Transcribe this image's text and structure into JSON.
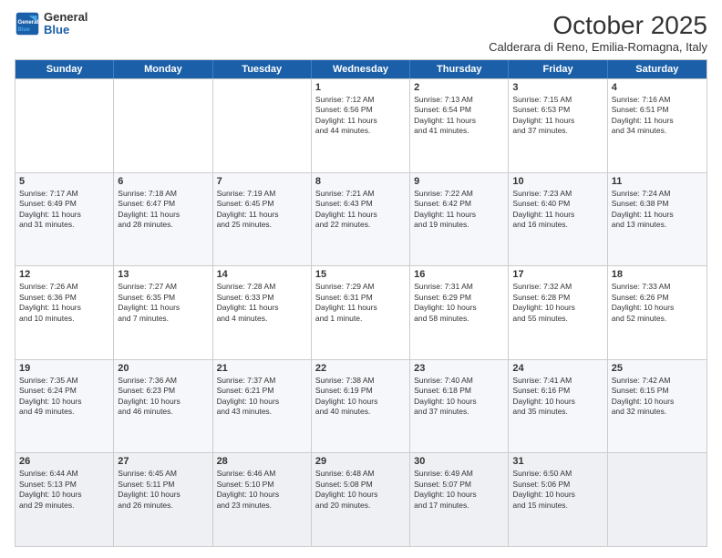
{
  "logo": {
    "line1": "General",
    "line2": "Blue"
  },
  "title": "October 2025",
  "subtitle": "Calderara di Reno, Emilia-Romagna, Italy",
  "days": [
    "Sunday",
    "Monday",
    "Tuesday",
    "Wednesday",
    "Thursday",
    "Friday",
    "Saturday"
  ],
  "rows": [
    [
      {
        "date": "",
        "info": ""
      },
      {
        "date": "",
        "info": ""
      },
      {
        "date": "",
        "info": ""
      },
      {
        "date": "1",
        "info": "Sunrise: 7:12 AM\nSunset: 6:56 PM\nDaylight: 11 hours\nand 44 minutes."
      },
      {
        "date": "2",
        "info": "Sunrise: 7:13 AM\nSunset: 6:54 PM\nDaylight: 11 hours\nand 41 minutes."
      },
      {
        "date": "3",
        "info": "Sunrise: 7:15 AM\nSunset: 6:53 PM\nDaylight: 11 hours\nand 37 minutes."
      },
      {
        "date": "4",
        "info": "Sunrise: 7:16 AM\nSunset: 6:51 PM\nDaylight: 11 hours\nand 34 minutes."
      }
    ],
    [
      {
        "date": "5",
        "info": "Sunrise: 7:17 AM\nSunset: 6:49 PM\nDaylight: 11 hours\nand 31 minutes."
      },
      {
        "date": "6",
        "info": "Sunrise: 7:18 AM\nSunset: 6:47 PM\nDaylight: 11 hours\nand 28 minutes."
      },
      {
        "date": "7",
        "info": "Sunrise: 7:19 AM\nSunset: 6:45 PM\nDaylight: 11 hours\nand 25 minutes."
      },
      {
        "date": "8",
        "info": "Sunrise: 7:21 AM\nSunset: 6:43 PM\nDaylight: 11 hours\nand 22 minutes."
      },
      {
        "date": "9",
        "info": "Sunrise: 7:22 AM\nSunset: 6:42 PM\nDaylight: 11 hours\nand 19 minutes."
      },
      {
        "date": "10",
        "info": "Sunrise: 7:23 AM\nSunset: 6:40 PM\nDaylight: 11 hours\nand 16 minutes."
      },
      {
        "date": "11",
        "info": "Sunrise: 7:24 AM\nSunset: 6:38 PM\nDaylight: 11 hours\nand 13 minutes."
      }
    ],
    [
      {
        "date": "12",
        "info": "Sunrise: 7:26 AM\nSunset: 6:36 PM\nDaylight: 11 hours\nand 10 minutes."
      },
      {
        "date": "13",
        "info": "Sunrise: 7:27 AM\nSunset: 6:35 PM\nDaylight: 11 hours\nand 7 minutes."
      },
      {
        "date": "14",
        "info": "Sunrise: 7:28 AM\nSunset: 6:33 PM\nDaylight: 11 hours\nand 4 minutes."
      },
      {
        "date": "15",
        "info": "Sunrise: 7:29 AM\nSunset: 6:31 PM\nDaylight: 11 hours\nand 1 minute."
      },
      {
        "date": "16",
        "info": "Sunrise: 7:31 AM\nSunset: 6:29 PM\nDaylight: 10 hours\nand 58 minutes."
      },
      {
        "date": "17",
        "info": "Sunrise: 7:32 AM\nSunset: 6:28 PM\nDaylight: 10 hours\nand 55 minutes."
      },
      {
        "date": "18",
        "info": "Sunrise: 7:33 AM\nSunset: 6:26 PM\nDaylight: 10 hours\nand 52 minutes."
      }
    ],
    [
      {
        "date": "19",
        "info": "Sunrise: 7:35 AM\nSunset: 6:24 PM\nDaylight: 10 hours\nand 49 minutes."
      },
      {
        "date": "20",
        "info": "Sunrise: 7:36 AM\nSunset: 6:23 PM\nDaylight: 10 hours\nand 46 minutes."
      },
      {
        "date": "21",
        "info": "Sunrise: 7:37 AM\nSunset: 6:21 PM\nDaylight: 10 hours\nand 43 minutes."
      },
      {
        "date": "22",
        "info": "Sunrise: 7:38 AM\nSunset: 6:19 PM\nDaylight: 10 hours\nand 40 minutes."
      },
      {
        "date": "23",
        "info": "Sunrise: 7:40 AM\nSunset: 6:18 PM\nDaylight: 10 hours\nand 37 minutes."
      },
      {
        "date": "24",
        "info": "Sunrise: 7:41 AM\nSunset: 6:16 PM\nDaylight: 10 hours\nand 35 minutes."
      },
      {
        "date": "25",
        "info": "Sunrise: 7:42 AM\nSunset: 6:15 PM\nDaylight: 10 hours\nand 32 minutes."
      }
    ],
    [
      {
        "date": "26",
        "info": "Sunrise: 6:44 AM\nSunset: 5:13 PM\nDaylight: 10 hours\nand 29 minutes."
      },
      {
        "date": "27",
        "info": "Sunrise: 6:45 AM\nSunset: 5:11 PM\nDaylight: 10 hours\nand 26 minutes."
      },
      {
        "date": "28",
        "info": "Sunrise: 6:46 AM\nSunset: 5:10 PM\nDaylight: 10 hours\nand 23 minutes."
      },
      {
        "date": "29",
        "info": "Sunrise: 6:48 AM\nSunset: 5:08 PM\nDaylight: 10 hours\nand 20 minutes."
      },
      {
        "date": "30",
        "info": "Sunrise: 6:49 AM\nSunset: 5:07 PM\nDaylight: 10 hours\nand 17 minutes."
      },
      {
        "date": "31",
        "info": "Sunrise: 6:50 AM\nSunset: 5:06 PM\nDaylight: 10 hours\nand 15 minutes."
      },
      {
        "date": "",
        "info": ""
      }
    ]
  ]
}
